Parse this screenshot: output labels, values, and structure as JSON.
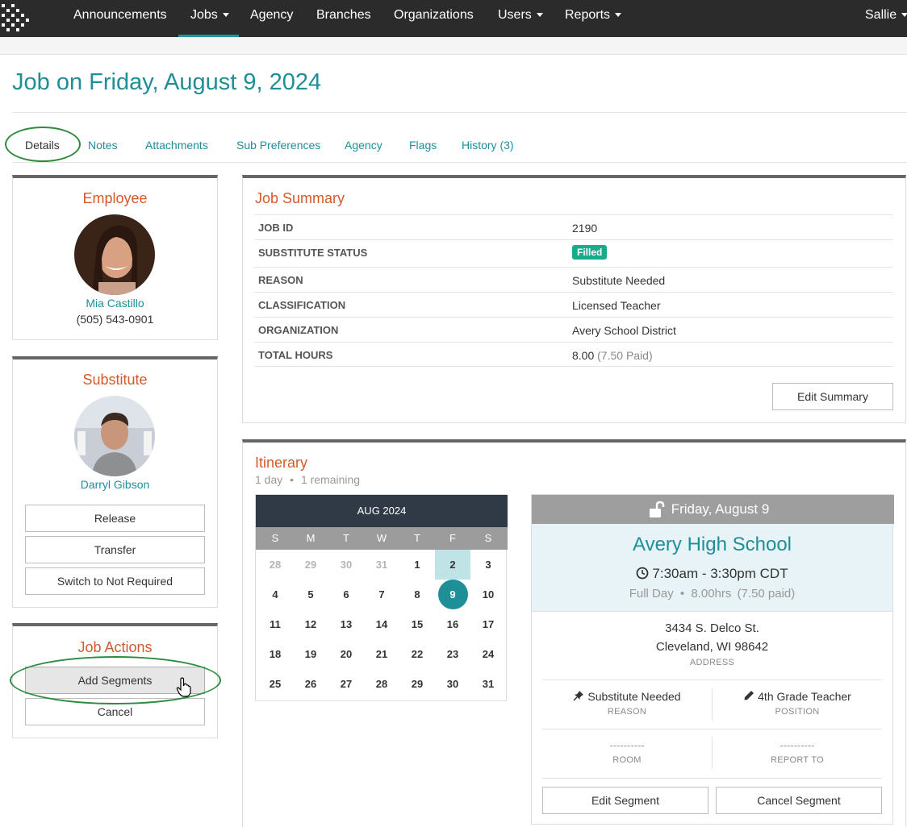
{
  "nav": {
    "items": [
      "Announcements",
      "Jobs",
      "Agency",
      "Branches",
      "Organizations",
      "Users",
      "Reports"
    ],
    "user": "Sallie"
  },
  "page": {
    "title": "Job on Friday, August 9, 2024"
  },
  "tabs": [
    "Details",
    "Notes",
    "Attachments",
    "Sub Preferences",
    "Agency",
    "Flags",
    "History (3)"
  ],
  "employee": {
    "title": "Employee",
    "name": "Mia Castillo",
    "phone": "(505) 543-0901"
  },
  "substitute": {
    "title": "Substitute",
    "name": "Darryl Gibson",
    "buttons": [
      "Release",
      "Transfer",
      "Switch to Not Required"
    ]
  },
  "job_actions": {
    "title": "Job Actions",
    "buttons": [
      "Add Segments",
      "Cancel"
    ]
  },
  "summary": {
    "title": "Job Summary",
    "rows": [
      {
        "label": "JOB ID",
        "value": "2190"
      },
      {
        "label": "SUBSTITUTE STATUS",
        "value": "Filled"
      },
      {
        "label": "REASON",
        "value": "Substitute Needed"
      },
      {
        "label": "CLASSIFICATION",
        "value": "Licensed Teacher"
      },
      {
        "label": "ORGANIZATION",
        "value": "Avery School District"
      },
      {
        "label": "TOTAL HOURS",
        "value": "8.00",
        "extra": "(7.50 Paid)"
      }
    ],
    "edit_button": "Edit Summary"
  },
  "itinerary": {
    "title": "Itinerary",
    "days": "1 day",
    "sep": "•",
    "remaining": "1 remaining"
  },
  "calendar": {
    "month": "AUG 2024",
    "dow": [
      "S",
      "M",
      "T",
      "W",
      "T",
      "F",
      "S"
    ],
    "weeks": [
      [
        "28",
        "29",
        "30",
        "31",
        "1",
        "2",
        "3"
      ],
      [
        "4",
        "5",
        "6",
        "7",
        "8",
        "9",
        "10"
      ],
      [
        "11",
        "12",
        "13",
        "14",
        "15",
        "16",
        "17"
      ],
      [
        "18",
        "19",
        "20",
        "21",
        "22",
        "23",
        "24"
      ],
      [
        "25",
        "26",
        "27",
        "28",
        "29",
        "30",
        "31"
      ]
    ],
    "muted": [
      "28",
      "29",
      "30",
      "31"
    ],
    "today": "2",
    "selected": "9"
  },
  "segment": {
    "date": "Friday, August 9",
    "school": "Avery High School",
    "time": "7:30am - 3:30pm CDT",
    "day_type": "Full Day",
    "hours": "8.00hrs",
    "paid": "(7.50 paid)",
    "sep": "•",
    "address_line1": "3434 S. Delco St.",
    "address_line2": "Cleveland, WI 98642",
    "address_label": "ADDRESS",
    "reason": "Substitute Needed",
    "reason_label": "REASON",
    "position": "4th Grade Teacher",
    "position_label": "POSITION",
    "room": "----------",
    "room_label": "ROOM",
    "report_to": "----------",
    "report_to_label": "REPORT TO",
    "edit_button": "Edit Segment",
    "cancel_button": "Cancel Segment"
  }
}
